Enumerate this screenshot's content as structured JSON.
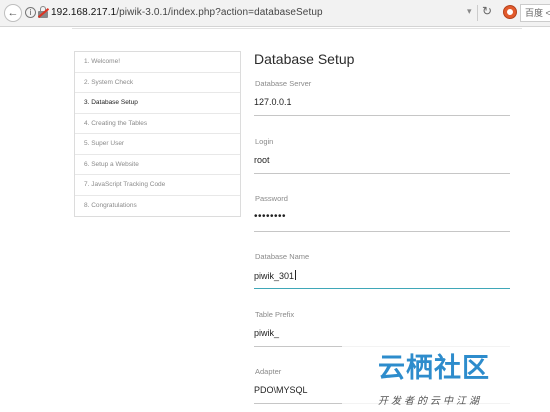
{
  "browser": {
    "url_host": "192.168.217.1",
    "url_path": "/piwik-3.0.1/index.php?action=databaseSetup",
    "search_text": "百度 <Ctr",
    "icons": {
      "back": "back-arrow-icon",
      "info": "info-icon",
      "insecure": "insecure-lock-icon",
      "dropdown": "chevron-down-icon",
      "reload": "reload-icon",
      "addon": "addon-icon"
    }
  },
  "steps": {
    "items": [
      {
        "label": "1. Welcome!"
      },
      {
        "label": "2. System Check"
      },
      {
        "label": "3. Database Setup"
      },
      {
        "label": "4. Creating the Tables"
      },
      {
        "label": "5. Super User"
      },
      {
        "label": "6. Setup a Website"
      },
      {
        "label": "7. JavaScript Tracking Code"
      },
      {
        "label": "8. Congratulations"
      }
    ],
    "active_index": 2
  },
  "form": {
    "title": "Database Setup",
    "fields": [
      {
        "label": "Database Server",
        "value": "127.0.0.1"
      },
      {
        "label": "Login",
        "value": "root"
      },
      {
        "label": "Password",
        "value": "••••••••"
      },
      {
        "label": "Database Name",
        "value": "piwik_301"
      },
      {
        "label": "Table Prefix",
        "value": "piwik_"
      },
      {
        "label": "Adapter",
        "value": "PDO\\MYSQL"
      }
    ],
    "focused_field": "Database Name"
  },
  "watermark": {
    "title": "云栖社区",
    "subtitle": "开发者的云中江湖"
  },
  "colors": {
    "focus_underline": "#3fa7b8",
    "watermark_blue": "#2d8ccc"
  }
}
